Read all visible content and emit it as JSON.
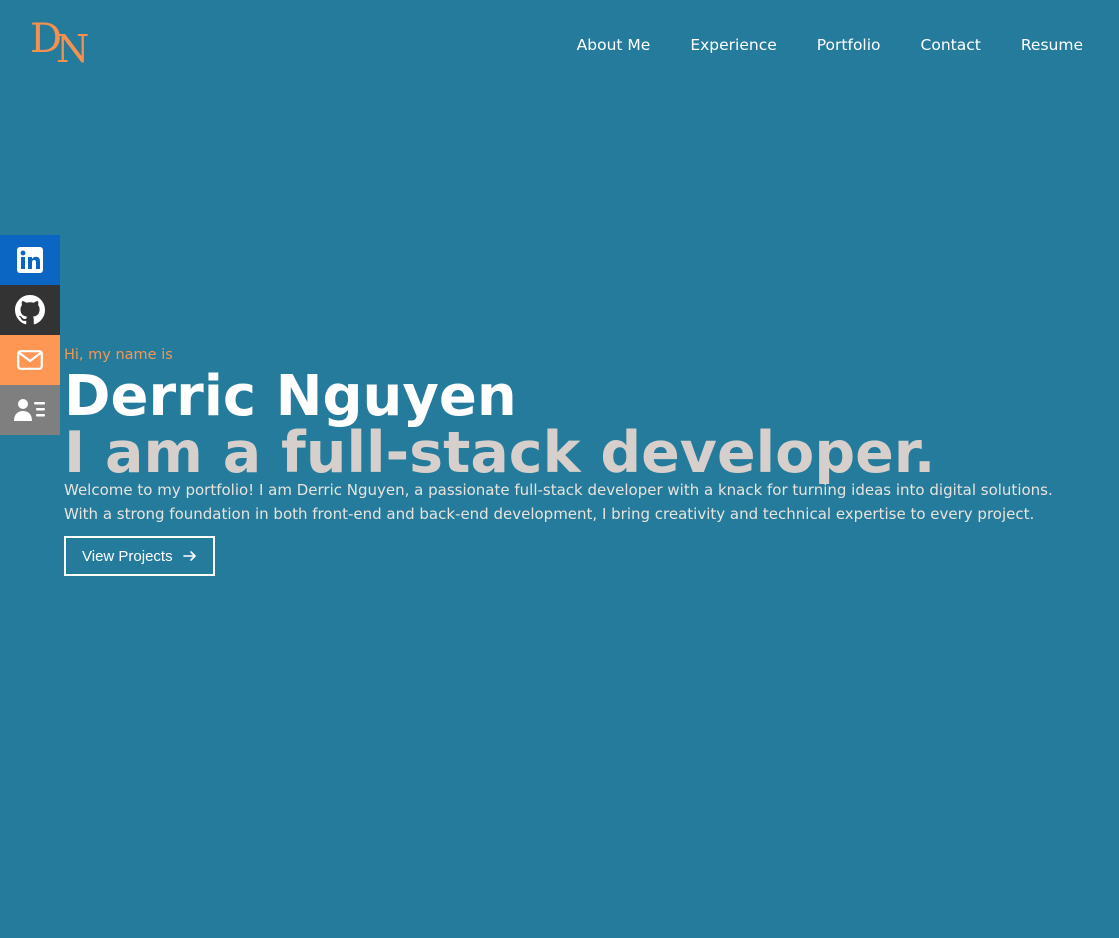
{
  "brand": {
    "logo_text": "DN",
    "logo_d": "D",
    "logo_n": "N",
    "logo_color": "#f5914e"
  },
  "nav": {
    "items": [
      {
        "label": "About Me"
      },
      {
        "label": "Experience"
      },
      {
        "label": "Portfolio"
      },
      {
        "label": "Contact"
      },
      {
        "label": "Resume"
      }
    ]
  },
  "social": [
    {
      "name": "linkedin-icon",
      "color": "#0a66c2"
    },
    {
      "name": "github-icon",
      "color": "#333333"
    },
    {
      "name": "mail-icon",
      "color": "#fe9654"
    },
    {
      "name": "resume-icon",
      "color": "#7f7f7f"
    }
  ],
  "hero": {
    "greeting": "Hi, my name is",
    "name": "Derric Nguyen",
    "tagline": "I am a full-stack developer.",
    "description": "Welcome to my portfolio! I am Derric Nguyen, a passionate full-stack developer with a knack for turning ideas into digital solutions. With a strong foundation in both front-end and back-end development, I bring creativity and technical expertise to every project.",
    "cta_label": "View Projects"
  },
  "colors": {
    "background": "#257b9c",
    "accent": "#f7964f",
    "tagline": "#d6cfcb"
  }
}
